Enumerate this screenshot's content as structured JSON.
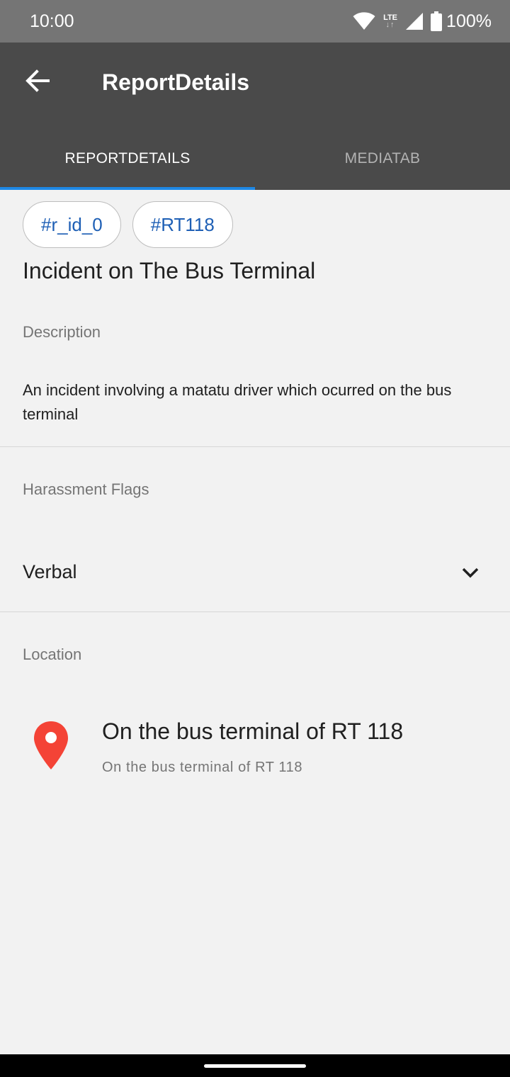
{
  "status_bar": {
    "time": "10:00",
    "network": "LTE",
    "battery": "100%",
    "icons": [
      "wifi-icon",
      "lte-icon",
      "signal-icon",
      "battery-icon"
    ]
  },
  "app_bar": {
    "title": "ReportDetails",
    "back_icon": "arrow-left-icon",
    "background": "#4a4a4a"
  },
  "tabs": [
    {
      "label": "REPORTDETAILS",
      "active": true
    },
    {
      "label": "MEDIATAB",
      "active": false
    }
  ],
  "accent_color": "#1e88e5",
  "chips": [
    "#r_id_0",
    "#RT118"
  ],
  "report": {
    "title": "Incident on The Bus Terminal",
    "description_label": "Description",
    "description": "An incident involving a matatu driver which ocurred on the bus terminal"
  },
  "harassment": {
    "label": "Harassment Flags",
    "selected": "Verbal"
  },
  "location": {
    "label": "Location",
    "title": "On the bus terminal of RT 118",
    "subtitle": "On the bus terminal of RT 118",
    "pin_color": "#f44336"
  }
}
